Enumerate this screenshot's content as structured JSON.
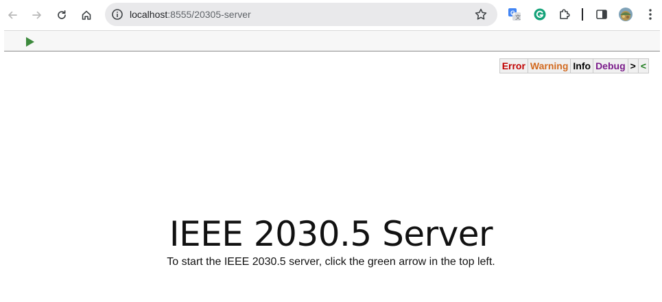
{
  "browser": {
    "url_host": "localhost",
    "url_rest": ":8555/20305-server",
    "icons": {
      "back": "back-arrow-icon",
      "forward": "forward-arrow-icon",
      "reload": "reload-icon",
      "home": "home-icon",
      "site_info": "site-info-icon",
      "bookmark": "bookmark-star-icon",
      "translate": "google-translate-icon",
      "grammarly": "grammarly-icon",
      "extensions": "extensions-puzzle-icon",
      "side_panel": "side-panel-icon",
      "profile": "profile-avatar",
      "menu": "kebab-menu-icon"
    }
  },
  "toolbar": {
    "run_icon": "play-icon",
    "run_color": "#3d8a3d"
  },
  "log_filter": {
    "error": "Error",
    "warning": "Warning",
    "info": "Info",
    "debug": "Debug",
    "next": ">",
    "prev": "<"
  },
  "main": {
    "title": "IEEE 2030.5 Server",
    "instructions": "To start the IEEE 2030.5 server, click the green arrow in the top left."
  }
}
